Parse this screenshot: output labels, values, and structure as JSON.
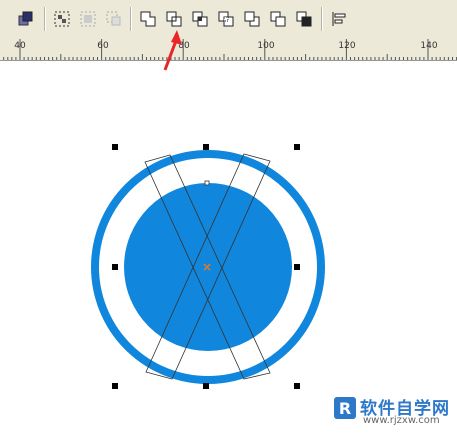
{
  "toolbar": {
    "buttons": [
      {
        "name": "to-front-icon",
        "enabled": true
      },
      {
        "name": "group-icon",
        "enabled": true
      },
      {
        "name": "ungroup-icon",
        "enabled": false
      },
      {
        "name": "ungroup-all-icon",
        "enabled": false
      },
      {
        "name": "weld-icon",
        "enabled": true
      },
      {
        "name": "trim-icon",
        "enabled": true
      },
      {
        "name": "intersect-icon",
        "enabled": true
      },
      {
        "name": "simplify-icon",
        "enabled": true
      },
      {
        "name": "front-minus-back-icon",
        "enabled": true
      },
      {
        "name": "back-minus-front-icon",
        "enabled": true
      },
      {
        "name": "create-boundary-icon",
        "enabled": true
      },
      {
        "name": "align-icon",
        "enabled": true
      }
    ],
    "highlighted": "trim-icon"
  },
  "ruler": {
    "labels": [
      "40",
      "60",
      "80",
      "100",
      "120",
      "140"
    ]
  },
  "canvas": {
    "shape_color": "#1087dc",
    "center_marker": "×",
    "center_marker_color": "#e07a2a"
  },
  "annotation": {
    "arrow_color": "#e8262a"
  },
  "watermark": {
    "logo_text": "R",
    "title": "软件自学网",
    "url": "www.rjzxw.com"
  }
}
